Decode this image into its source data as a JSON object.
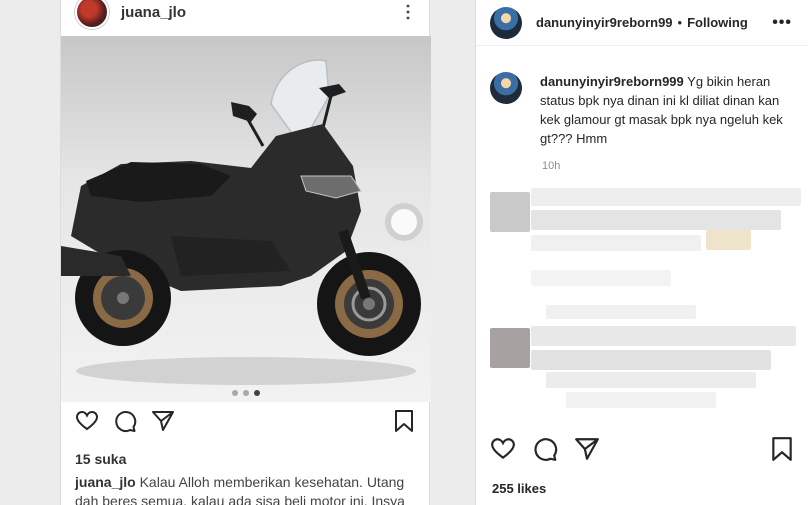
{
  "inner_post": {
    "username": "juana_jlo",
    "likes": "15 suka",
    "caption_user": "juana_jlo",
    "caption_text": "Kalau Alloh memberikan kesehatan. Utang dah beres semua, kalau ada sisa beli motor ini. Insya",
    "carousel_slides": 3,
    "carousel_active": 3
  },
  "post": {
    "username": "danunyinyir9reborn99",
    "separator": "•",
    "follow_label": "Following",
    "more_label": "•••"
  },
  "comment": {
    "username": "danunyinyir9reborn999",
    "text": "Yg bikin heran status bpk nya dinan ini kl diliat dinan kan kek glamour gt masak bpk nya ngeluh kek gt??? Hmm",
    "time": "10h"
  },
  "likes": "255 likes",
  "colors": {
    "text": "#262626",
    "muted": "#8e8e8e",
    "border": "#dbdbdb"
  }
}
